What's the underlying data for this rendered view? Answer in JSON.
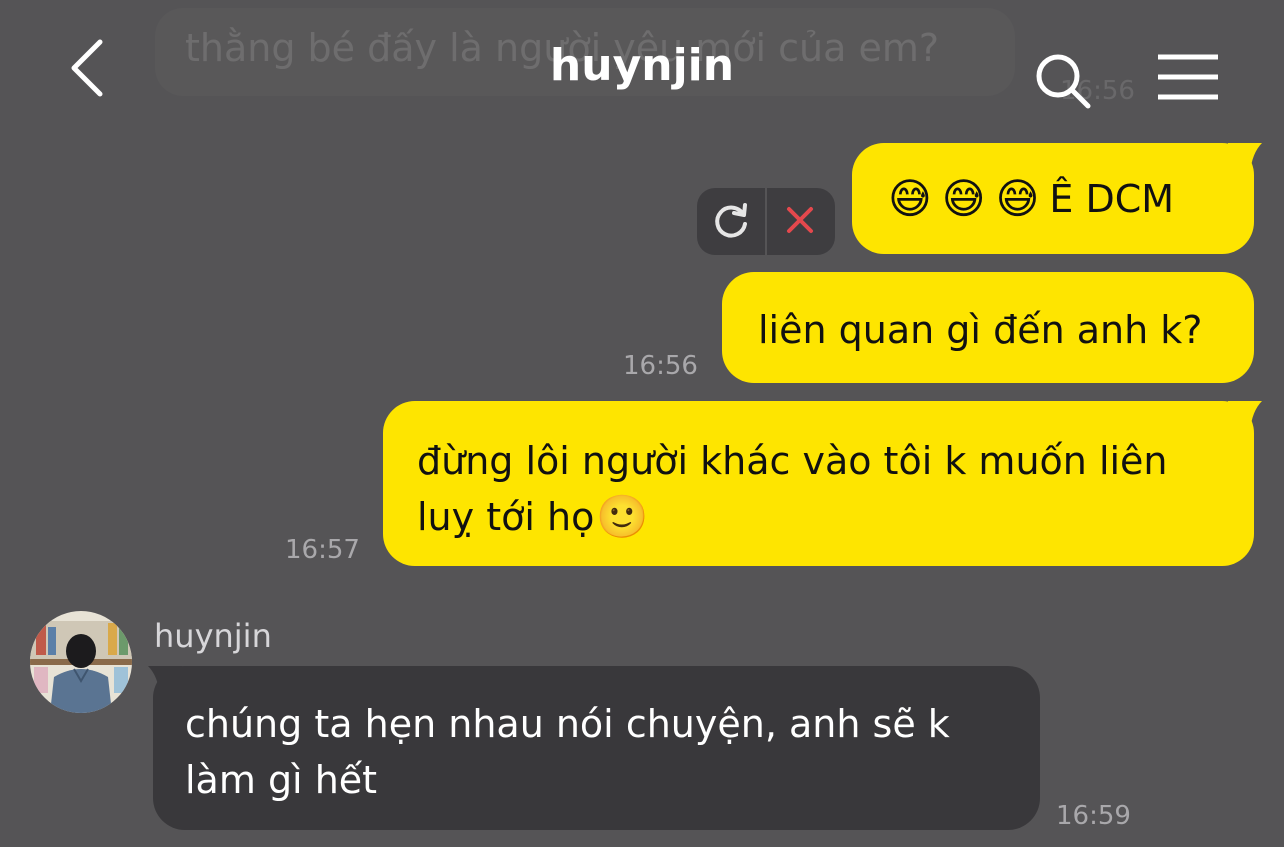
{
  "header": {
    "title": "huynjin",
    "back_icon": "chevron-left-icon",
    "search_icon": "search-icon",
    "menu_icon": "hamburger-menu-icon"
  },
  "ghost_message": {
    "text": "thằng bé đấy là người yêu mới của em?",
    "time": "16:56"
  },
  "messages": [
    {
      "sender": "me",
      "emojis": [
        "😅",
        "😅",
        "😅"
      ],
      "text": "Ê DCM",
      "status": "failed",
      "retry_icon": "refresh-icon",
      "cancel_icon": "close-icon"
    },
    {
      "sender": "me",
      "text": "liên quan gì đến anh k?",
      "time": "16:56"
    },
    {
      "sender": "me",
      "text_line1": "đừng lôi người khác vào tôi k muốn liên",
      "text_line2": "luỵ tới họ",
      "trailing_emoji": "🙂",
      "time": "16:57"
    },
    {
      "sender": "huynjin",
      "sender_name": "huynjin",
      "text_line1": "chúng ta hẹn nhau nói chuyện, anh sẽ k",
      "text_line2": "làm gì hết",
      "time": "16:59"
    }
  ],
  "colors": {
    "background": "#555456",
    "my_bubble": "#FEE500",
    "their_bubble": "#39383b",
    "cancel_red": "#E5484D"
  }
}
